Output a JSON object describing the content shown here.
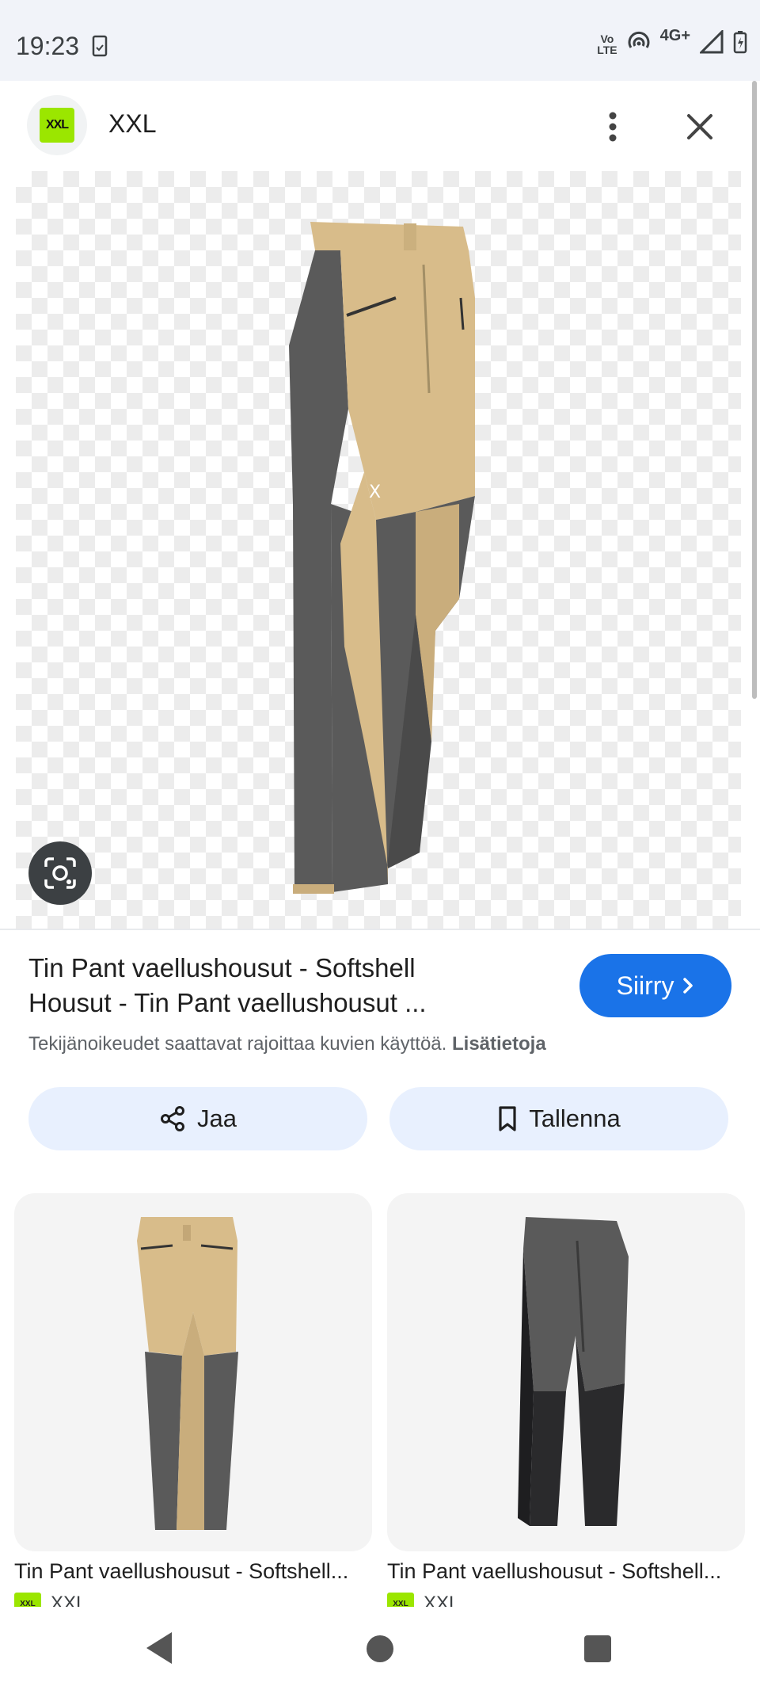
{
  "status_bar": {
    "time": "19:23",
    "volte_top": "Vo",
    "volte_bottom": "LTE",
    "network": "4G+"
  },
  "header": {
    "logo_text": "XXL",
    "site_name": "XXL"
  },
  "product": {
    "title": "Tin Pant vaellushousut - Softshell Housut - Tin Pant vaellushousut ...",
    "goto_label": "Siirry",
    "copyright_text": "Tekijänoikeudet saattavat rajoittaa kuvien käyttöä.",
    "copyright_link": "Lisätietoja"
  },
  "actions": {
    "share_label": "Jaa",
    "save_label": "Tallenna"
  },
  "related": [
    {
      "title": "Tin Pant vaellushousut - Softshell...",
      "source": "XXL"
    },
    {
      "title": "Tin Pant vaellushousut - Softshell...",
      "source": "XXL"
    }
  ],
  "colors": {
    "accent_blue": "#1a73e8",
    "brand_green": "#9be600",
    "pant_tan": "#d8bc8a",
    "pant_gray": "#5a5a5a",
    "pant_black": "#2a2a2c"
  }
}
